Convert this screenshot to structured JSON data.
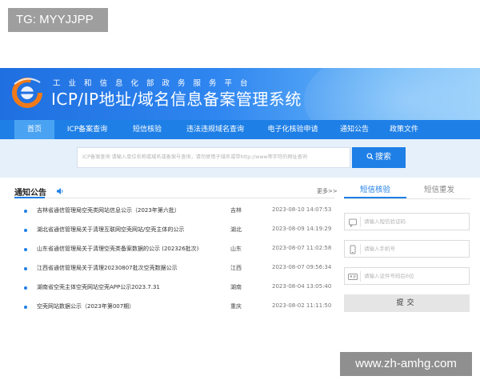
{
  "watermarks": {
    "top_left": "TG: MYYJJPP",
    "bottom_right": "www.zh-amhg.com"
  },
  "header": {
    "subtitle": "工业和信息化部政务服务平台",
    "title": "ICP/IP地址/域名信息备案管理系统",
    "colors": {
      "gradient_start": "#1f6fe0",
      "gradient_end": "#8ecbfa",
      "logo_orange": "#f07a1a"
    }
  },
  "nav": {
    "items": [
      {
        "label": "首页",
        "active": true
      },
      {
        "label": "ICP备案查询",
        "active": false
      },
      {
        "label": "短信核验",
        "active": false
      },
      {
        "label": "违法违规域名查询",
        "active": false
      },
      {
        "label": "电子化核验申请",
        "active": false
      },
      {
        "label": "通知公告",
        "active": false
      },
      {
        "label": "政策文件",
        "active": false
      }
    ],
    "color": "#1e7fe6"
  },
  "search": {
    "placeholder": "ICP备案查询   请输入单位名称或域名或备案号查询，请勿使用子域名或带http://www等字符的网址查询",
    "button_label": "搜索",
    "icon": "search-icon"
  },
  "notices": {
    "title": "通知公告",
    "more": "更多>>",
    "items": [
      {
        "title": "吉林省通信管理局空壳类网站信息公示（2023年第六批）",
        "province": "吉林",
        "date": "2023-08-10 14:07:53"
      },
      {
        "title": "湖北省通信管理局关于清理互联网空壳网站/空壳主体的公示",
        "province": "湖北",
        "date": "2023-08-09 14:19:29"
      },
      {
        "title": "山东省通信管理局关于清理空壳类备案数据的公示 (202326批次)",
        "province": "山东",
        "date": "2023-08-07 11:02:58"
      },
      {
        "title": "江西省通信管理局关于清理20230807批次空壳数据公示",
        "province": "江西",
        "date": "2023-08-07 09:56:34"
      },
      {
        "title": "湖南省空壳主体空壳网站空壳APP公示2023.7.31",
        "province": "湖南",
        "date": "2023-08-04 13:05:40"
      },
      {
        "title": "空壳网站数据公示（2023年第007期）",
        "province": "重庆",
        "date": "2023-08-02 11:11:50"
      }
    ]
  },
  "sms_panel": {
    "tabs": [
      {
        "label": "短信核验",
        "active": true
      },
      {
        "label": "短信重发",
        "active": false
      }
    ],
    "fields": [
      {
        "placeholder": "请输入短信验证码",
        "icon": "sms-code-icon"
      },
      {
        "placeholder": "请输入手机号",
        "icon": "phone-icon"
      },
      {
        "placeholder": "请输入证件号码后6位",
        "icon": "id-card-icon"
      }
    ],
    "submit_label": "提交"
  }
}
